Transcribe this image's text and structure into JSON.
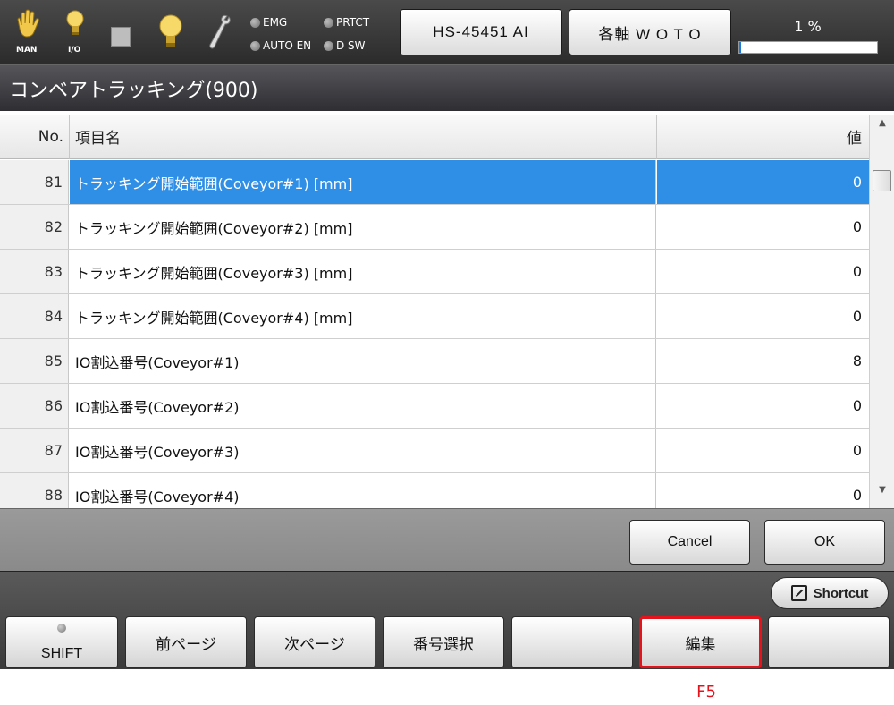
{
  "topbar": {
    "icons": [
      {
        "icon": "hand-icon",
        "label": "MAN"
      },
      {
        "icon": "lightbulb-icon",
        "label": "I/O"
      },
      {
        "icon": "square-icon",
        "label": ""
      },
      {
        "icon": "lightbulb-icon",
        "label": ""
      },
      {
        "icon": "wrench-icon",
        "label": ""
      }
    ],
    "indicators": [
      "EMG",
      "PRTCT",
      "AUTO EN",
      "D SW"
    ],
    "robot_button": "HS-45451 AI",
    "axis_button": "各軸 W O T O",
    "progress_label": "1 %",
    "progress_value": 0.01
  },
  "page_title": "コンベアトラッキング(900)",
  "table": {
    "headers": {
      "no": "No.",
      "name": "項目名",
      "value": "値"
    },
    "selected_index": 0,
    "rows": [
      {
        "no": "81",
        "name": "トラッキング開始範囲(Coveyor#1) [mm]",
        "value": "0"
      },
      {
        "no": "82",
        "name": "トラッキング開始範囲(Coveyor#2) [mm]",
        "value": "0"
      },
      {
        "no": "83",
        "name": "トラッキング開始範囲(Coveyor#3) [mm]",
        "value": "0"
      },
      {
        "no": "84",
        "name": "トラッキング開始範囲(Coveyor#4) [mm]",
        "value": "0"
      },
      {
        "no": "85",
        "name": "IO割込番号(Coveyor#1)",
        "value": "8"
      },
      {
        "no": "86",
        "name": "IO割込番号(Coveyor#2)",
        "value": "0"
      },
      {
        "no": "87",
        "name": "IO割込番号(Coveyor#3)",
        "value": "0"
      },
      {
        "no": "88",
        "name": "IO割込番号(Coveyor#4)",
        "value": "0"
      }
    ]
  },
  "actions": {
    "cancel": "Cancel",
    "ok": "OK"
  },
  "shortcut": "Shortcut",
  "fkeys": [
    {
      "label": "SHIFT"
    },
    {
      "label": "前ページ"
    },
    {
      "label": "次ページ"
    },
    {
      "label": "番号選択"
    },
    {
      "label": ""
    },
    {
      "label": "編集"
    },
    {
      "label": ""
    }
  ],
  "highlight_caption": "F5",
  "colors": {
    "selection": "#2f8fe6",
    "highlight": "#e5131c",
    "progress": "#1e78d8"
  }
}
